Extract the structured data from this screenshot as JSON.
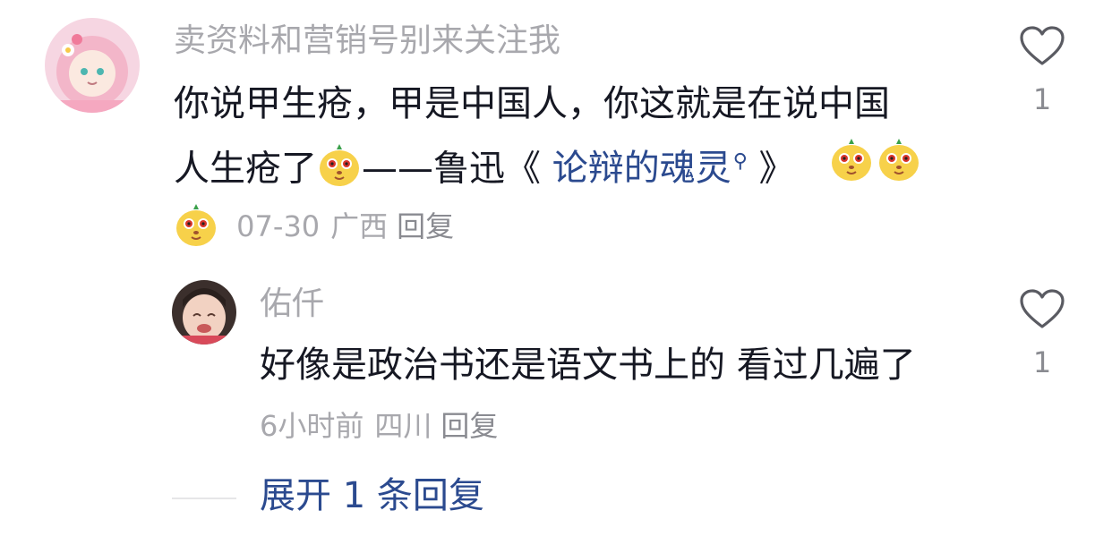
{
  "comment_1": {
    "username": "卖资料和营销号别来关注我",
    "line1": "你说甲生疮，甲是中国人，你这就是在说中国",
    "line2_prefix": "人生疮了",
    "line2_mid": "——鲁迅《 ",
    "link_text": "论辩的魂灵",
    "line2_suffix": " 》",
    "date": "07-30",
    "location": "广西",
    "reply_label": "回复",
    "like_count": "1",
    "emoji_icon": "doge-emoji-icon"
  },
  "comment_2": {
    "username": "佑仟",
    "text": "好像是政治书还是语文书上的 看过几遍了",
    "time": "6小时前",
    "location": "四川",
    "reply_label": "回复",
    "like_count": "1"
  },
  "expand_replies": "展开 1 条回复",
  "colors": {
    "username": "#a8a8ad",
    "text": "#161823",
    "link": "#2b4a8f",
    "meta": "#a8a8ad"
  }
}
